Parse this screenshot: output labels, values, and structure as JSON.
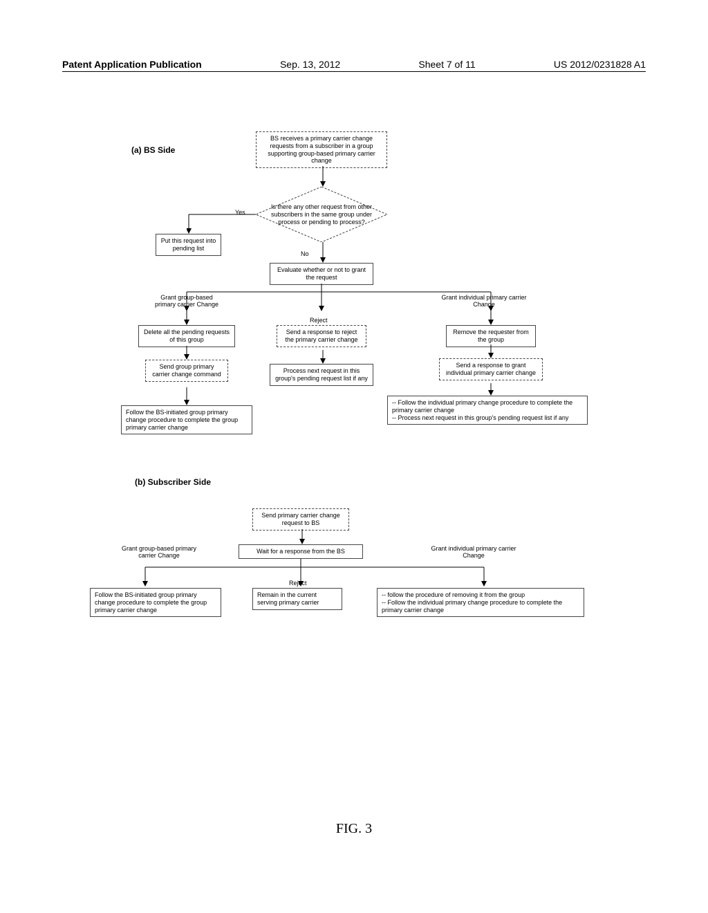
{
  "header": {
    "left": "Patent Application Publication",
    "date": "Sep. 13, 2012",
    "sheet": "Sheet 7 of 11",
    "docnum": "US 2012/0231828 A1"
  },
  "sectionA": {
    "label": "(a)  BS Side",
    "node1": "BS receives a primary carrier change requests from a subscriber in a group supporting group-based primary carrier change",
    "diamond": "Is there any other request from other subscribers in the same group under process or pending to process?",
    "yes": "Yes",
    "no": "No",
    "pending": "Put this request into pending list",
    "evaluate": "Evaluate whether or not to grant the request",
    "grantGroup": "Grant group-based primary carrier Change",
    "grantIndiv": "Grant individual primary carrier Change",
    "reject": "Reject",
    "deletePending": "Delete all the pending requests of this group",
    "sendGroupCmd": "Send group primary carrier change command",
    "followGroup": "Follow the BS-initiated group primary change procedure to complete the group primary carrier change",
    "rejectResp": "Send a response to reject the primary carrier change",
    "processNext": "Process next request in this group's pending request list if any",
    "removeRequester": "Remove the requester from the group",
    "grantIndivResp": "Send a response to grant individual primary carrier change",
    "followIndiv": "-- Follow the individual primary change procedure to complete the  primary carrier change\n-- Process next request in this group's pending request list if any"
  },
  "sectionB": {
    "label": "(b)  Subscriber Side",
    "sendReq": "Send primary carrier change request to BS",
    "wait": "Wait for a response from the BS",
    "grantGroup": "Grant group-based primary carrier Change",
    "grantIndiv": "Grant individual primary carrier Change",
    "reject": "Reject",
    "followGroup": "Follow the BS-initiated group primary change procedure to complete the group primary carrier change",
    "remain": "Remain in the current serving primary carrier",
    "followIndiv": "-- follow the procedure of removing it from the group\n-- Follow the individual primary change procedure to complete the  primary carrier change"
  },
  "caption": "FIG. 3"
}
